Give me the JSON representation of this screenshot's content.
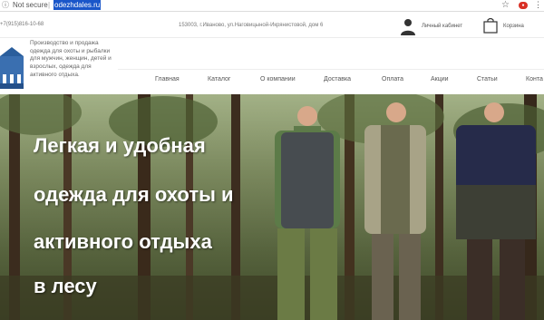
{
  "browser": {
    "security_label": "Not secure",
    "url": "odezhdales.ru"
  },
  "header": {
    "phone": "+7(915)816-10-68",
    "address": "153003, г.Иваново, ул.Наговицыной-Икрянистовой, дом 6",
    "cabinet_label": "Личный кабинет",
    "cart_label": "Корзина",
    "tagline": "Производство и продажа одежда для охоты и рыбалки для мужчин, женщин, детей и взрослых, одежда для активного отдыха."
  },
  "nav": {
    "items": [
      {
        "label": "Главная"
      },
      {
        "label": "Каталог"
      },
      {
        "label": "О компании"
      },
      {
        "label": "Доставка"
      },
      {
        "label": "Оплата"
      },
      {
        "label": "Акции"
      },
      {
        "label": "Статьи"
      },
      {
        "label": "Конта"
      }
    ]
  },
  "hero": {
    "lines": [
      "Легкая и удобная",
      "одежда для охоты и",
      "активного отдыха",
      "в лесу"
    ]
  }
}
